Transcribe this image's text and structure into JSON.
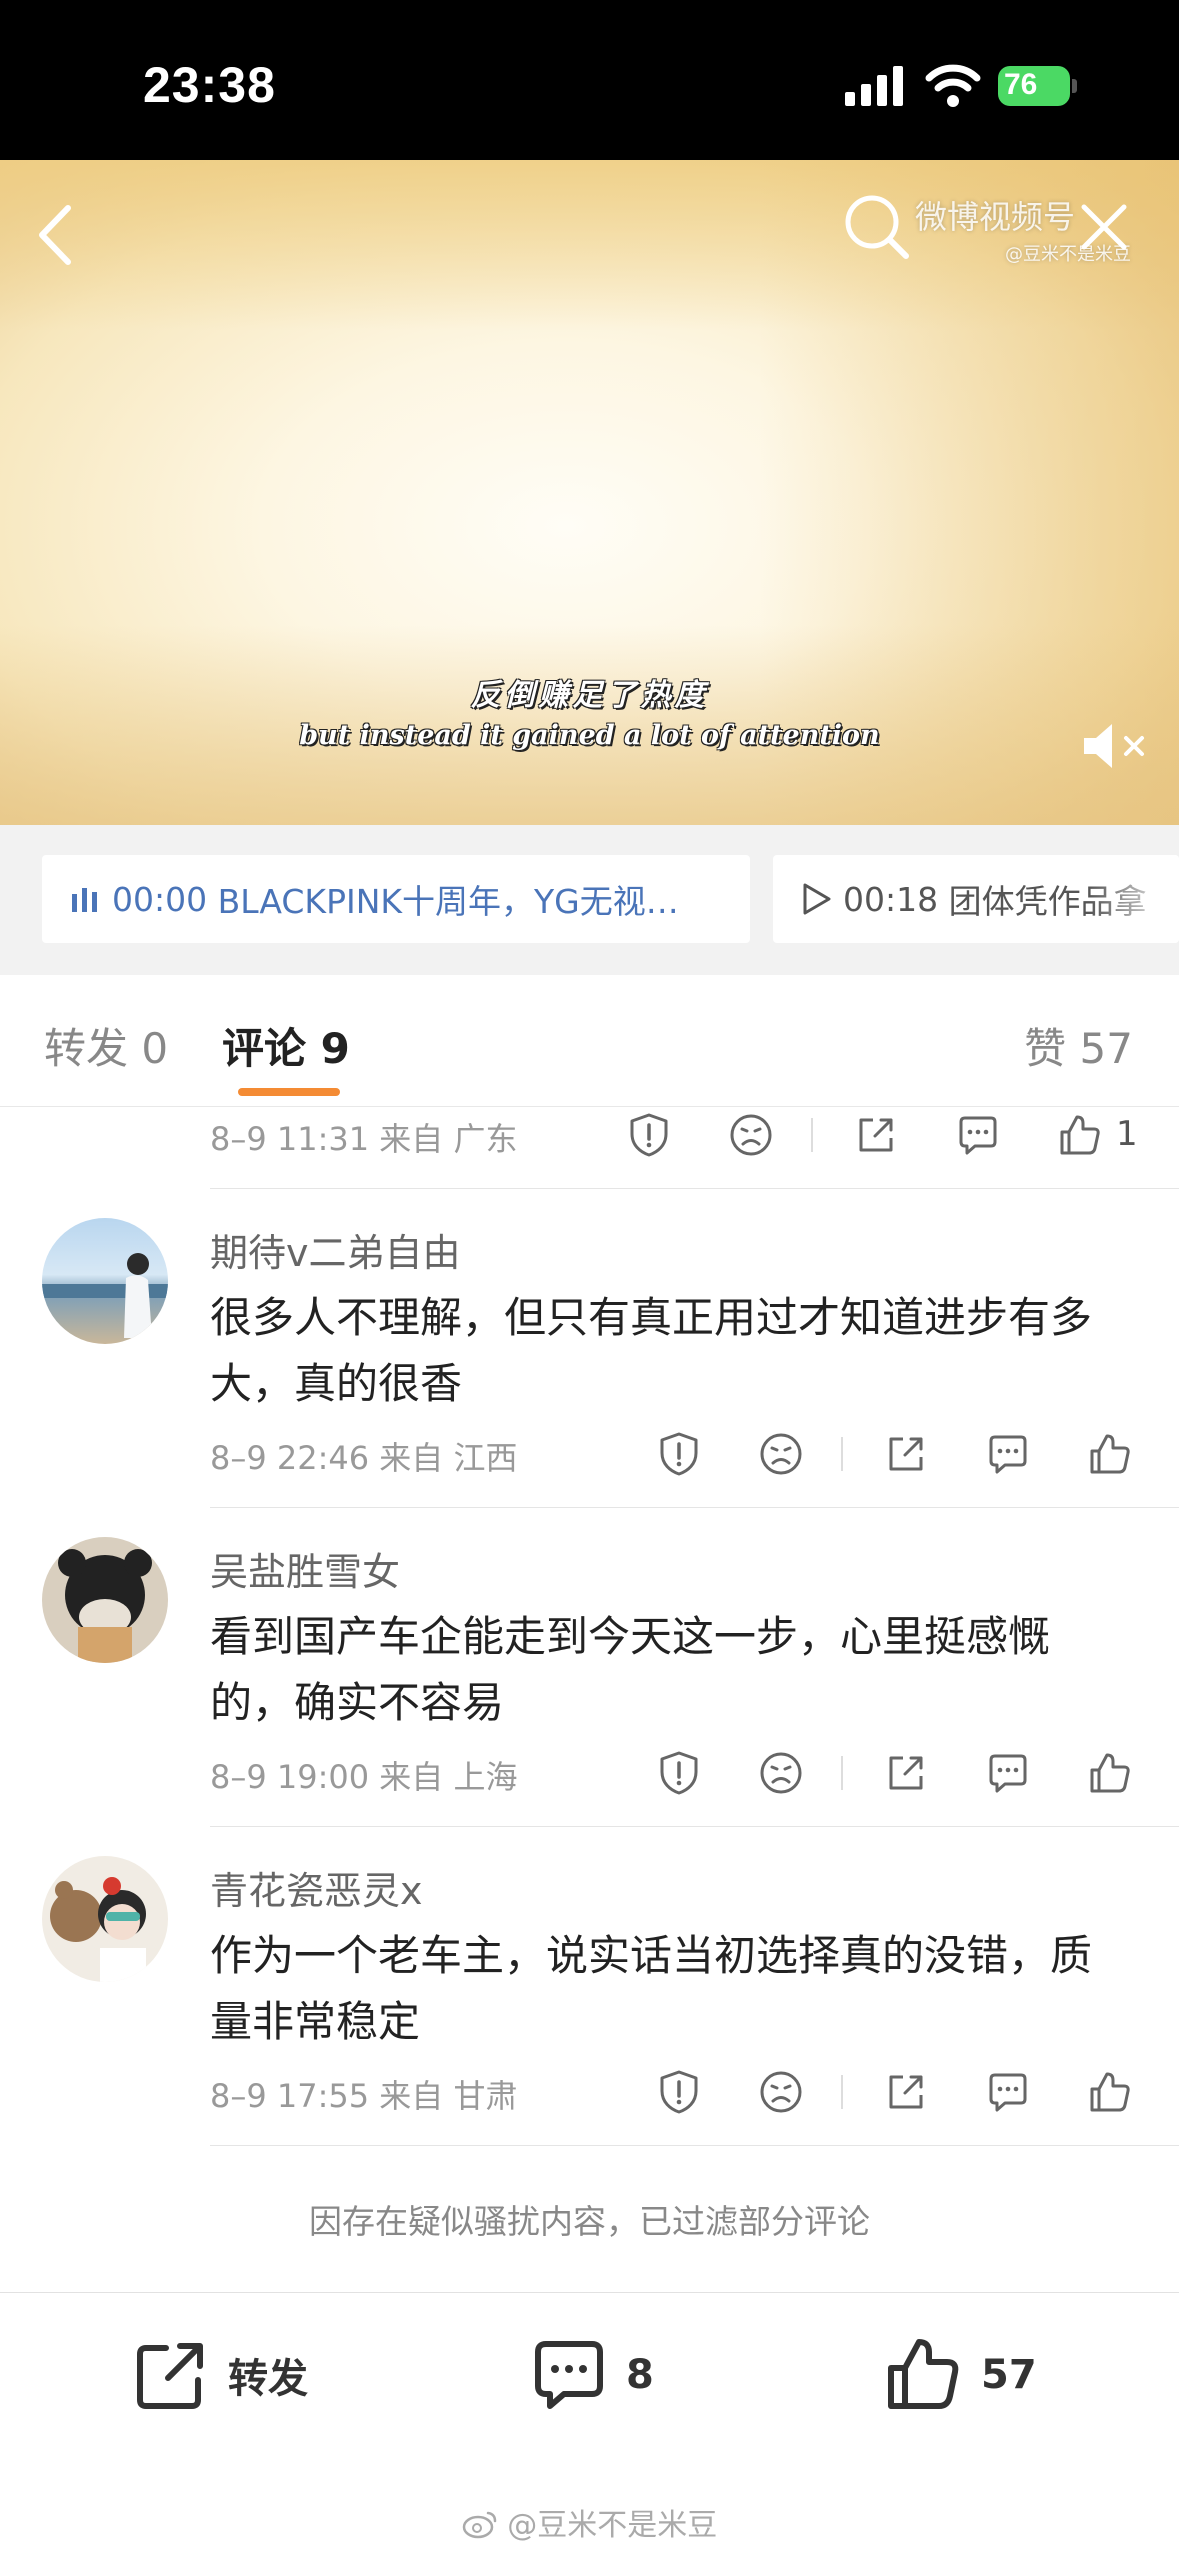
{
  "status_bar": {
    "time": "23:38",
    "battery": "76"
  },
  "video": {
    "watermark_line1": "微博视频号",
    "watermark_line2": "@豆米不是米豆",
    "subtitle_zh": "反倒赚足了热度",
    "subtitle_en": "but instead it gained a lot of attention"
  },
  "related": [
    {
      "time": "00:00",
      "title": "BLACKPINK十周年，YG无视…"
    },
    {
      "time": "00:18",
      "title": "团体凭作品拿"
    }
  ],
  "tabs": {
    "repost_label": "转发",
    "repost_count": "0",
    "comment_label": "评论",
    "comment_count": "9",
    "like_label": "赞",
    "like_count": "57"
  },
  "comments": [
    {
      "meta": "8–9 11:31 来自 广东",
      "likes": "1"
    },
    {
      "user": "期待v二弟自由",
      "text": "很多人不理解，但只有真正用过才知道进步有多大，真的很香",
      "meta": "8–9 22:46 来自 江西",
      "likes": ""
    },
    {
      "user": "吴盐胜雪女",
      "text": "看到国产车企能走到今天这一步，心里挺感慨的，确实不容易",
      "meta": "8–9 19:00 来自 上海",
      "likes": ""
    },
    {
      "user": "青花瓷恶灵x",
      "text": "作为一个老车主，说实话当初选择真的没错，质量非常稳定",
      "meta": "8–9 17:55 来自 甘肃",
      "likes": ""
    }
  ],
  "filter_note": "因存在疑似骚扰内容，已过滤部分评论",
  "bottom_bar": {
    "repost_label": "转发",
    "comment_count": "8",
    "like_count": "57",
    "watermark": "@豆米不是米豆"
  },
  "colors": {
    "accent": "#f48b34",
    "link": "#4a74b8",
    "battery": "#4bd964"
  },
  "icons": [
    "back-icon",
    "search-icon",
    "close-icon",
    "mute-icon",
    "report-icon",
    "dislike-icon",
    "share-icon",
    "reply-icon",
    "thumbs-up-icon",
    "repost-icon",
    "comment-icon",
    "weibo-logo-icon"
  ]
}
